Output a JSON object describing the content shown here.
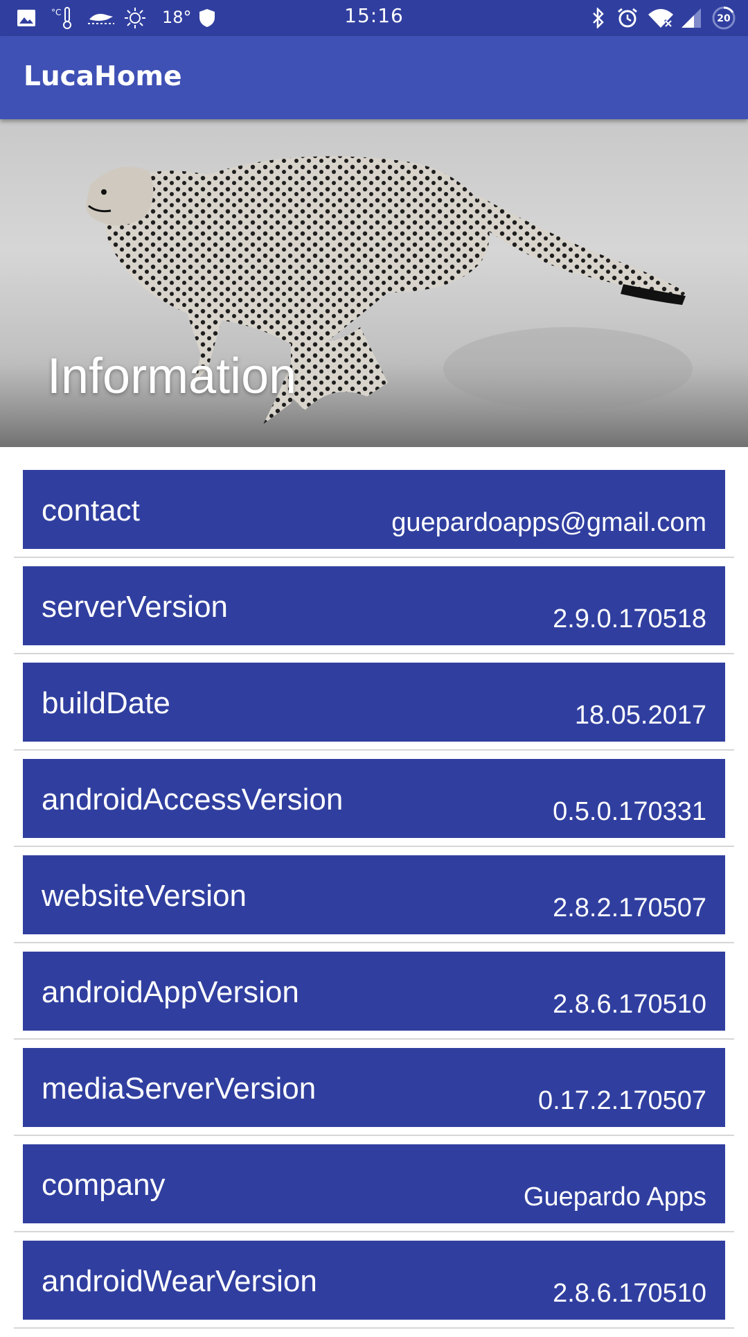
{
  "status_bar": {
    "time": "15:16",
    "temperature": "18°",
    "battery_level": "20",
    "left_icons": [
      "image-icon",
      "thermometer-icon",
      "weather-icon",
      "sun-icon",
      "shield-icon"
    ],
    "right_icons": [
      "bluetooth-icon",
      "alarm-icon",
      "wifi-icon",
      "signal-icon",
      "battery-icon"
    ]
  },
  "app_bar": {
    "title": "LucaHome"
  },
  "header": {
    "title": "Information",
    "image": "cheetah-running"
  },
  "info_items": [
    {
      "key": "contact",
      "value": "guepardoapps@gmail.com"
    },
    {
      "key": "serverVersion",
      "value": "2.9.0.170518"
    },
    {
      "key": "buildDate",
      "value": "18.05.2017"
    },
    {
      "key": "androidAccessVersion",
      "value": "0.5.0.170331"
    },
    {
      "key": "websiteVersion",
      "value": "2.8.2.170507"
    },
    {
      "key": "androidAppVersion",
      "value": "2.8.6.170510"
    },
    {
      "key": "mediaServerVersion",
      "value": "0.17.2.170507"
    },
    {
      "key": "company",
      "value": "Guepardo Apps"
    },
    {
      "key": "androidWearVersion",
      "value": "2.8.6.170510"
    }
  ],
  "colors": {
    "status_bar": "#303F9F",
    "app_bar": "#3F51B5",
    "card": "#303F9F",
    "text": "#FFFFFF"
  }
}
